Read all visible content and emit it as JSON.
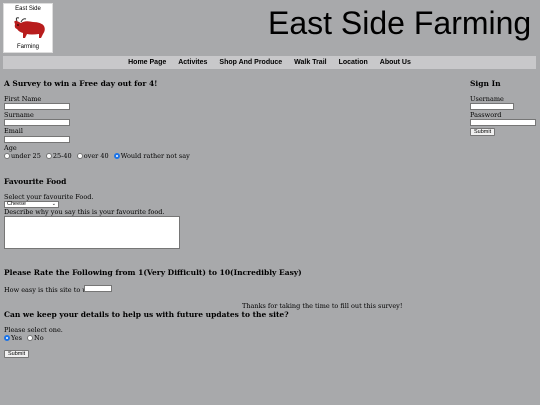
{
  "logo": {
    "line1": "East Side",
    "line2": "Farming"
  },
  "site_title": "East Side Farming",
  "nav": [
    "Home Page",
    "Activites",
    "Shop And Produce",
    "Walk Trail",
    "Location",
    "About Us"
  ],
  "survey": {
    "heading": "A Survey to win a Free day out for 4!",
    "first_name_label": "First Name",
    "surname_label": "Surname",
    "email_label": "Email",
    "age_label": "Age",
    "age_options": [
      "under 25",
      "25-40",
      "over 40",
      "Would rather not say"
    ]
  },
  "food": {
    "heading": "Favourite Food",
    "select_label": "Select your favourite Food.",
    "selected": "Cheese",
    "describe_label": "Describe why you say this is your favourite food."
  },
  "rate": {
    "heading": "Please Rate the Following from 1(Very Difficult) to 10(Incredibly Easy)",
    "question": "How easy is this site to use??"
  },
  "thanks": "Thanks for taking the time to fill out this survey!",
  "keep": {
    "heading": "Can we keep your details to help us with future updates to the site?",
    "prompt": "Please select one.",
    "yes": "Yes",
    "no": "No",
    "submit": "Submit"
  },
  "signin": {
    "heading": "Sign In",
    "username_label": "Username",
    "password_label": "Password",
    "submit": "Submit"
  },
  "colors": {
    "background": "#a8a9ab",
    "nav": "#c8c8ca",
    "radio_selected": "#1a73e8"
  }
}
